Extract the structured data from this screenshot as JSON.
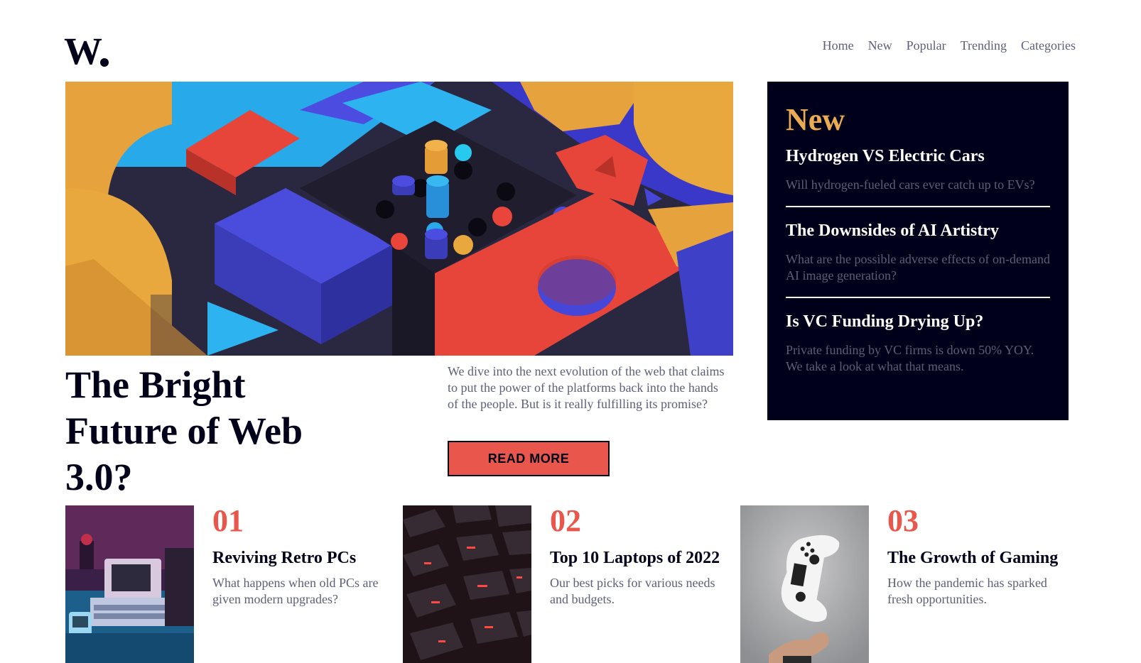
{
  "logo": {
    "text": "W."
  },
  "nav": {
    "items": [
      "Home",
      "New",
      "Popular",
      "Trending",
      "Categories"
    ]
  },
  "hero": {
    "title": "The Bright Future of Web 3.0?",
    "description": "We dive into the next evolution of the web that claims to put the power of the platforms back into the hands of the people. But is it really fulfilling its promise?",
    "button": "READ MORE"
  },
  "new_panel": {
    "heading": "New",
    "items": [
      {
        "title": "Hydrogen VS Electric Cars",
        "desc": "Will hydrogen-fueled cars ever catch up to EVs?"
      },
      {
        "title": "The Downsides of AI Artistry",
        "desc": "What are the possible adverse effects of on-demand AI image generation?"
      },
      {
        "title": "Is VC Funding Drying Up?",
        "desc": "Private funding by VC firms is down 50% YOY. We take a look at what that means."
      }
    ]
  },
  "cards": [
    {
      "num": "01",
      "title": "Reviving Retro PCs",
      "desc": "What happens when old PCs are given modern upgrades?"
    },
    {
      "num": "02",
      "title": "Top 10 Laptops of 2022",
      "desc": "Our best picks for various needs and budgets."
    },
    {
      "num": "03",
      "title": "The Growth of Gaming",
      "desc": "How the pandemic has sparked fresh opportunities."
    }
  ],
  "colors": {
    "accent_red": "#e9564c",
    "accent_orange": "#e9ab53",
    "dark_navy": "#00001a",
    "grayish_blue": "#5d5f79"
  }
}
